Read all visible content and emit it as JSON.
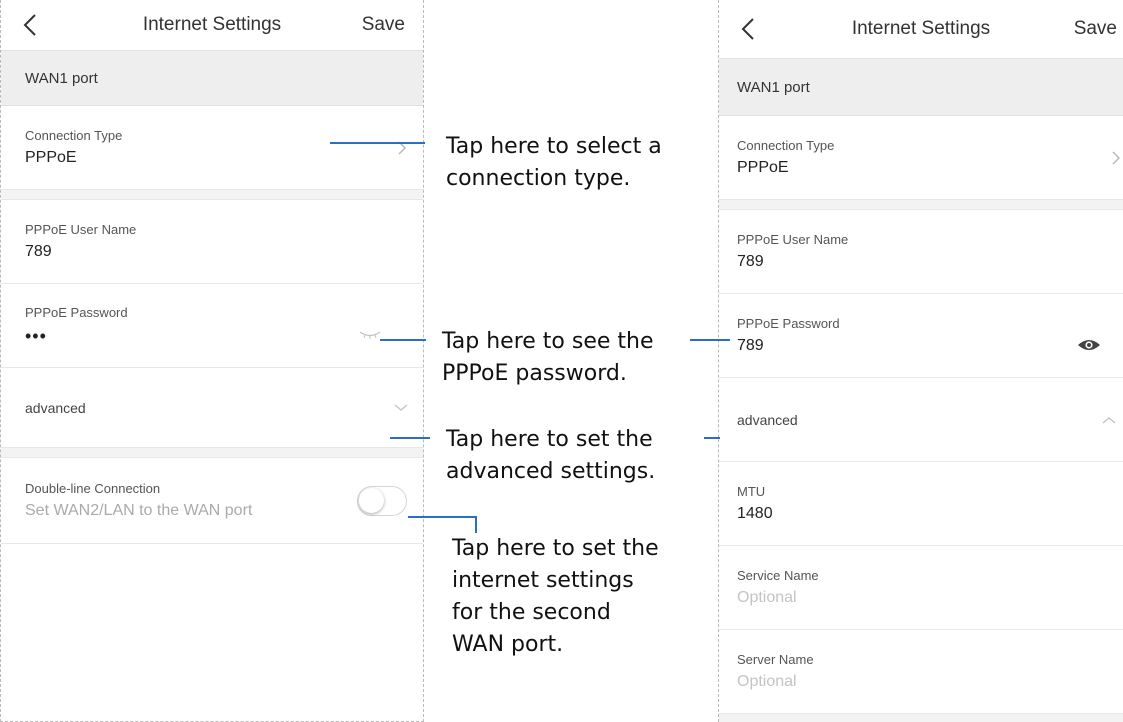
{
  "left_screen": {
    "title": "Internet Settings",
    "save_label": "Save",
    "section_header": "WAN1 port",
    "connection_type": {
      "label": "Connection Type",
      "value": "PPPoE"
    },
    "pppoe_user": {
      "label": "PPPoE User Name",
      "value": "789"
    },
    "pppoe_password": {
      "label": "PPPoE Password",
      "value": "•••"
    },
    "advanced_label": "advanced",
    "double_line": {
      "label": "Double-line Connection",
      "value": "Set WAN2/LAN to the WAN port",
      "enabled": false
    }
  },
  "right_screen": {
    "title": "Internet Settings",
    "save_label": "Save",
    "section_header": "WAN1 port",
    "connection_type": {
      "label": "Connection Type",
      "value": "PPPoE"
    },
    "pppoe_user": {
      "label": "PPPoE User Name",
      "value": "789"
    },
    "pppoe_password": {
      "label": "PPPoE Password",
      "value": "789"
    },
    "advanced_label": "advanced",
    "mtu": {
      "label": "MTU",
      "value": "1480"
    },
    "service_name": {
      "label": "Service Name",
      "placeholder": "Optional"
    },
    "server_name": {
      "label": "Server Name",
      "placeholder": "Optional"
    }
  },
  "annotations": {
    "connection_type": [
      "Tap here to select a",
      "connection type."
    ],
    "password": [
      "Tap here to see the",
      "PPPoE password."
    ],
    "advanced": [
      "Tap here to set the",
      "advanced settings."
    ],
    "double_line": [
      "Tap here to set the",
      "internet settings",
      "for the second",
      "WAN port."
    ]
  },
  "colors": {
    "callout_line": "#2a6fc1",
    "section_bg": "#eeeeef"
  },
  "icons": [
    "chevron-left-icon",
    "chevron-right-icon",
    "eye-closed-icon",
    "eye-open-icon",
    "chevron-down-icon",
    "chevron-up-icon"
  ]
}
